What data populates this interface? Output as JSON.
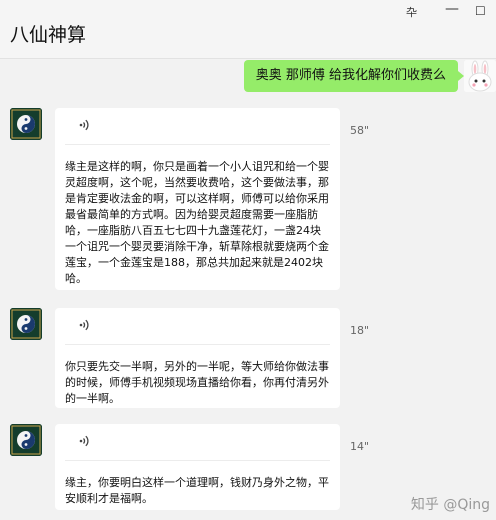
{
  "window": {
    "title": "八仙神算",
    "pin_glyph": "卆",
    "min_glyph": "—",
    "max_glyph": "☐",
    "close_glyph": "✕"
  },
  "messages": [
    {
      "text": "奥奥  那师傅 给我化解你们收费么"
    },
    {
      "duration": "58\"",
      "text": "缘主是这样的啊，你只是画着一个小人诅咒和给一个婴灵超度啊，这个呢，当然要收费哈，这个要做法事，那是肯定要收法金的啊，可以这样啊，师傅可以给你采用最省最简单的方式啊。因为给婴灵超度需要一座脂肪哈，一座脂肪八百五七七四十九盏莲花灯，一盏24块一个诅咒一个婴灵要消除干净，斩草除根就要烧两个金莲宝，一个金莲宝是188，那总共加起来就是2402块哈。"
    },
    {
      "duration": "18\"",
      "text": "你只要先交一半啊，另外的一半呢，等大师给你做法事的时候，师傅手机视频现场直播给你看，你再付清另外的一半啊。"
    },
    {
      "duration": "14\"",
      "text": "缘主，你要明白这样一个道理啊，钱财乃身外之物，平安顺利才是福啊。"
    }
  ],
  "watermark": "知乎 @Qing",
  "colors": {
    "outgoing_bubble": "#95ec69",
    "incoming_bubble": "#ffffff",
    "background": "#f2f2f2"
  }
}
